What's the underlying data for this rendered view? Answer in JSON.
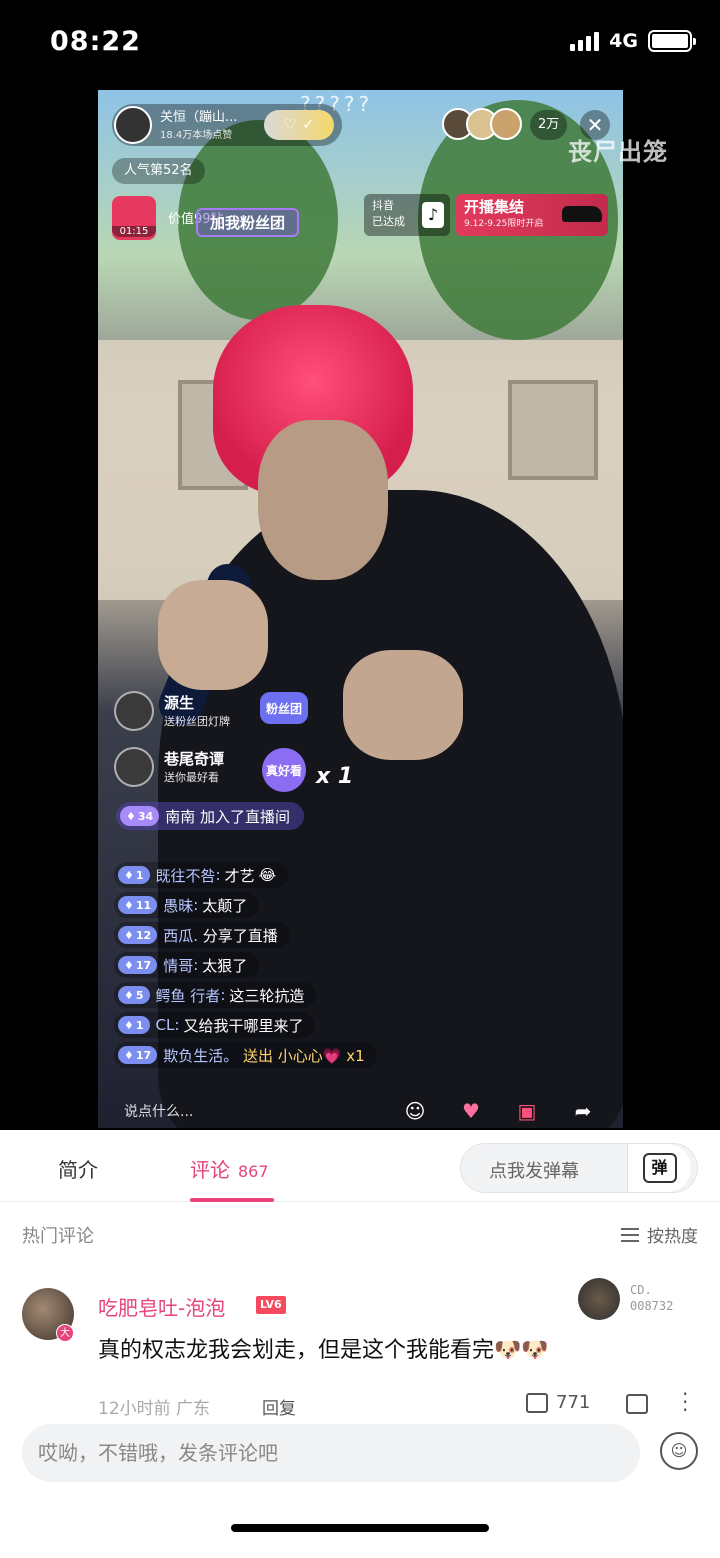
{
  "status_bar": {
    "time": "08:22",
    "network": "4G",
    "battery_level": 1.0
  },
  "live": {
    "host": {
      "name": "关恒（蹦山...",
      "likes": "18.4万本场点赞"
    },
    "rank": "人气第52名",
    "viewer_count": "2万",
    "watermark": "丧尸出笼",
    "question_marks": "?????",
    "pk_time": "01:15",
    "value_label": "价值99钻",
    "fans_banner": "加我粉丝团",
    "douyin_card": {
      "title": "抖音",
      "status": "已达成"
    },
    "event": {
      "title": "开播集结",
      "subtitle": "9.12-9.25限时开启"
    },
    "gifts": [
      {
        "user": "源生",
        "action": "送粉丝团灯牌",
        "gift_label": "粉丝团"
      },
      {
        "user": "巷尾奇谭",
        "action": "送你最好看",
        "gift_label": "真好看",
        "multiplier": "x 1"
      }
    ],
    "join": {
      "level": "34",
      "user": "南南",
      "text": "加入了直播间"
    },
    "comments": [
      {
        "level": "1",
        "user": "既往不咎",
        "text": "才艺",
        "emoji": "😂"
      },
      {
        "level": "11",
        "user": "愚昧",
        "text": "太颠了"
      },
      {
        "level": "12",
        "user": "西瓜.",
        "text": "分享了直播"
      },
      {
        "level": "17",
        "user": "情哥",
        "text": "太狠了"
      },
      {
        "level": "5",
        "user": "鳄鱼 行者",
        "text": "这三轮抗造"
      },
      {
        "level": "1",
        "user": "CL",
        "text": "又给我干哪里来了"
      },
      {
        "level": "17",
        "user": "欺负生活。",
        "text": "送出 小心心💗 x1"
      }
    ],
    "input_placeholder": "说点什么...",
    "actions": [
      "emoji-icon",
      "heart-icon",
      "gift-icon",
      "share-icon"
    ]
  },
  "panel": {
    "tabs": [
      {
        "label": "简介"
      },
      {
        "label": "评论",
        "count": "867"
      }
    ],
    "danmaku_button": "点我发弹幕",
    "danmaku_icon": "弹",
    "hot_title": "热门评论",
    "sort_label": "按热度",
    "comment": {
      "user": "吃肥皂吐-泡泡",
      "level": "LV6",
      "badge": "大",
      "medal_text": "CD.\n008732",
      "body": "真的权志龙我会划走，但是这个我能看完🐶🐶",
      "time": "12小时前",
      "location": "广东",
      "reply": "回复",
      "likes": "771"
    },
    "reply_placeholder": "哎呦，不错哦，发条评论吧"
  },
  "colors": {
    "accent": "#e6447a",
    "level_blue": "#7c8ff0"
  }
}
